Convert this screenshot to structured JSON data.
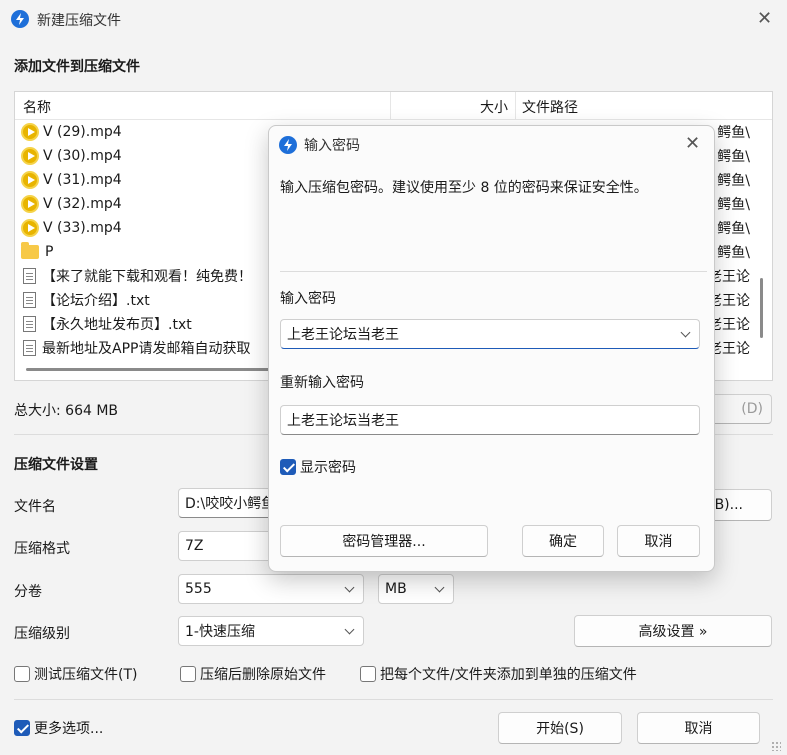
{
  "window": {
    "title": "新建压缩文件",
    "close_glyph": "✕"
  },
  "files_section": {
    "title": "添加文件到压缩文件",
    "columns": {
      "name": "名称",
      "size": "大小",
      "path": "文件路径"
    },
    "rows": [
      {
        "icon": "video-file-icon",
        "name": "V (29).mp4",
        "path": "鳄鱼\\"
      },
      {
        "icon": "video-file-icon",
        "name": "V (30).mp4",
        "path": "鳄鱼\\"
      },
      {
        "icon": "video-file-icon",
        "name": "V (31).mp4",
        "path": "鳄鱼\\"
      },
      {
        "icon": "video-file-icon",
        "name": "V (32).mp4",
        "path": "鳄鱼\\"
      },
      {
        "icon": "video-file-icon",
        "name": "V (33).mp4",
        "path": "鳄鱼\\"
      },
      {
        "icon": "folder-icon",
        "name": "P",
        "path": "鳄鱼\\"
      },
      {
        "icon": "text-file-icon",
        "name": "【来了就能下载和观看！纯免费！",
        "path": "老王论"
      },
      {
        "icon": "text-file-icon",
        "name": "【论坛介绍】.txt",
        "path": "老王论"
      },
      {
        "icon": "text-file-icon",
        "name": "【永久地址发布页】.txt",
        "path": "老王论"
      },
      {
        "icon": "text-file-icon",
        "name": "最新地址及APP请发邮箱自动获取",
        "path": "老王论"
      }
    ],
    "total_size": "总大小: 664 MB",
    "delete_btn_partial": "(D)"
  },
  "settings": {
    "title": "压缩文件设置",
    "filename_label": "文件名",
    "filename_value": "D:\\咬咬小鳄鱼",
    "browse_partial": "(B)...",
    "format_label": "压缩格式",
    "format_value": "7Z",
    "split_label": "分卷",
    "split_value": "555",
    "split_unit": "MB",
    "level_label": "压缩级别",
    "level_value": "1-快速压缩",
    "advanced_btn": "高级设置 »",
    "test_chk": "测试压缩文件(T)",
    "delete_chk": "压缩后删除原始文件",
    "each_chk": "把每个文件/文件夹添加到单独的压缩文件"
  },
  "footer": {
    "more_options": "更多选项...",
    "start_btn": "开始(S)",
    "cancel_btn": "取消"
  },
  "password_dialog": {
    "title": "输入密码",
    "close_glyph": "✕",
    "hint": "输入压缩包密码。建议使用至少 8 位的密码来保证安全性。",
    "pwd_label": "输入密码",
    "pwd_value": "上老王论坛当老王",
    "repwd_label": "重新输入密码",
    "repwd_value": "上老王论坛当老王",
    "show_pwd": "显示密码",
    "manager_btn": "密码管理器...",
    "ok_btn": "确定",
    "cancel_btn": "取消"
  },
  "colors": {
    "accent": "#1e5bb8",
    "app_icon": "#1e6fd9"
  }
}
